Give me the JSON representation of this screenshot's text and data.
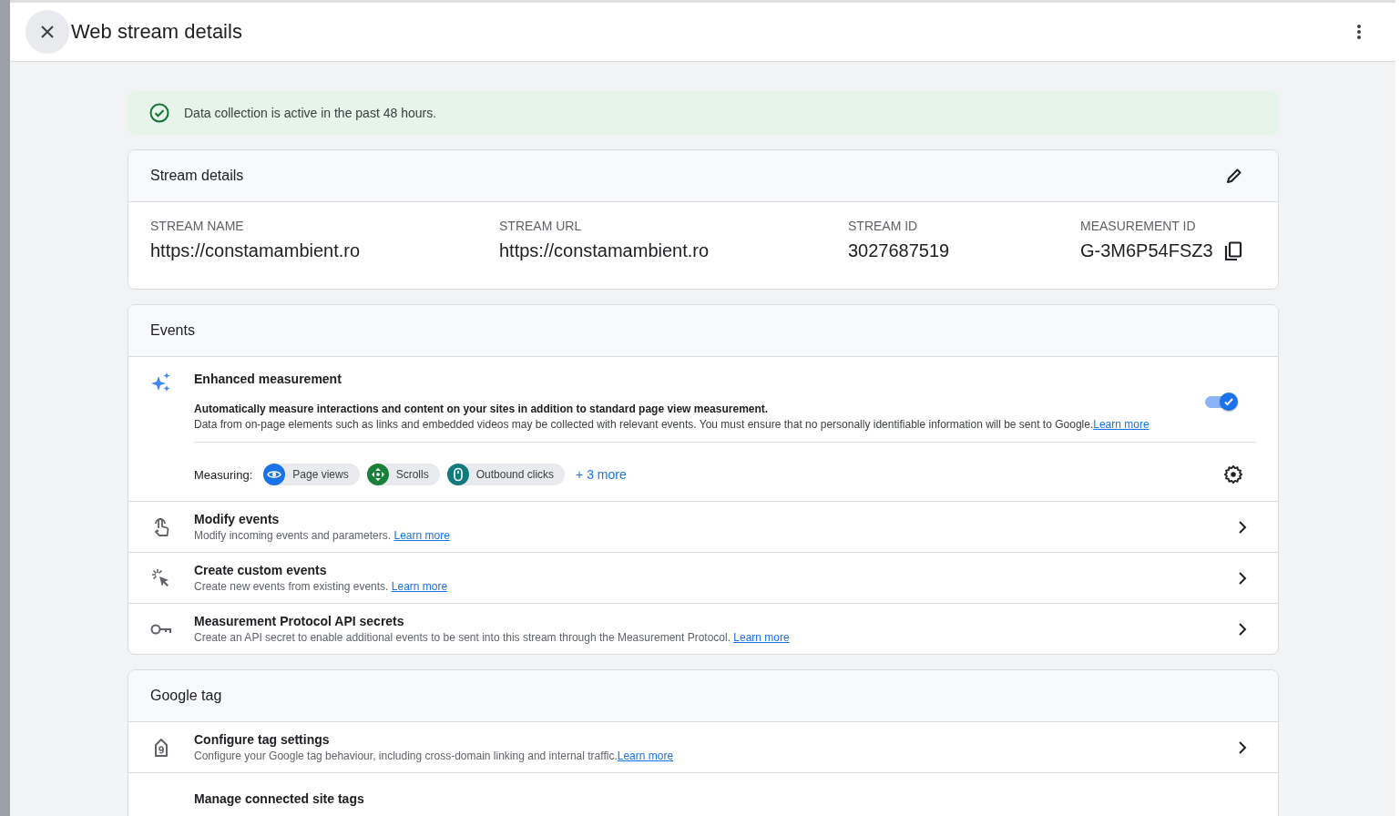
{
  "header": {
    "title": "Web stream details"
  },
  "banner": {
    "text": "Data collection is active in the past 48 hours."
  },
  "stream_details": {
    "title": "Stream details",
    "fields": [
      {
        "label": "STREAM NAME",
        "value": "https://constamambient.ro",
        "copyable": false
      },
      {
        "label": "STREAM URL",
        "value": "https://constamambient.ro",
        "copyable": false
      },
      {
        "label": "STREAM ID",
        "value": "3027687519",
        "copyable": false
      },
      {
        "label": "MEASUREMENT ID",
        "value": "G-3M6P54FSZ3",
        "copyable": true
      }
    ]
  },
  "events": {
    "title": "Events",
    "enhanced": {
      "title": "Enhanced measurement",
      "line1": "Automatically measure interactions and content on your sites in addition to standard page view measurement.",
      "line2": "Data from on-page elements such as links and embedded videos may be collected with relevant events. You must ensure that no personally identifiable information will be sent to Google.",
      "link": "Learn more",
      "on": true,
      "measuring_label": "Measuring:",
      "chips": [
        {
          "kind": "eye",
          "label": "Page views",
          "color": "#1a73e8"
        },
        {
          "kind": "scroll",
          "label": "Scrolls",
          "color": "#188038"
        },
        {
          "kind": "mouse",
          "label": "Outbound clicks",
          "color": "#12797c"
        }
      ],
      "more": "+ 3 more"
    },
    "rows": [
      {
        "kind": "touch",
        "title": "Modify events",
        "desc": "Modify incoming events and parameters.",
        "link": "Learn more"
      },
      {
        "kind": "cursor",
        "title": "Create custom events",
        "desc": "Create new events from existing events.",
        "link": "Learn more"
      },
      {
        "kind": "key",
        "title": "Measurement Protocol API secrets",
        "desc": "Create an API secret to enable additional events to be sent into this stream through the Measurement Protocol.",
        "link": "Learn more"
      }
    ]
  },
  "google_tag": {
    "title": "Google tag",
    "rows": [
      {
        "kind": "tag",
        "title": "Configure tag settings",
        "desc": "Configure your Google tag behaviour, including cross-domain linking and internal traffic.",
        "link": "Learn more"
      },
      {
        "kind": "none",
        "title": "Manage connected site tags"
      }
    ]
  }
}
